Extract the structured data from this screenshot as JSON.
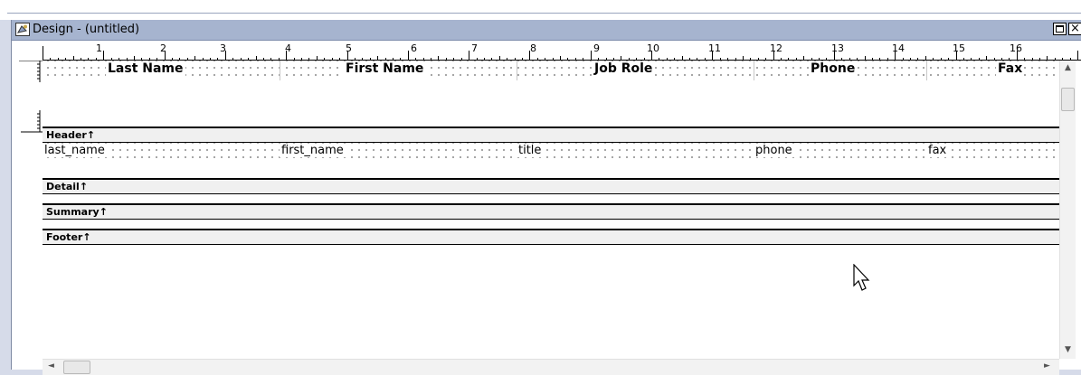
{
  "window": {
    "title": "Design - (untitled)",
    "maximize_label": "",
    "close_label": "×"
  },
  "ruler": {
    "marks": [
      "1",
      "2",
      "3",
      "4",
      "5",
      "6",
      "7",
      "8",
      "9",
      "10",
      "11",
      "12",
      "13",
      "14",
      "15",
      "16"
    ]
  },
  "header_band": {
    "columns": [
      "Last Name",
      "First Name",
      "Job Role",
      "Phone",
      "Fax"
    ]
  },
  "detail_band": {
    "fields": [
      "last_name",
      "first_name",
      "title",
      "phone",
      "fax"
    ]
  },
  "bands": {
    "header": "Header↑",
    "detail": "Detail↑",
    "summary": "Summary↑",
    "footer": "Footer↑"
  },
  "scroll": {
    "up": "▲",
    "down": "▼",
    "left": "◄",
    "right": "►"
  },
  "icons": {
    "title": "design-window-icon",
    "cursor": "mouse-pointer-icon"
  }
}
